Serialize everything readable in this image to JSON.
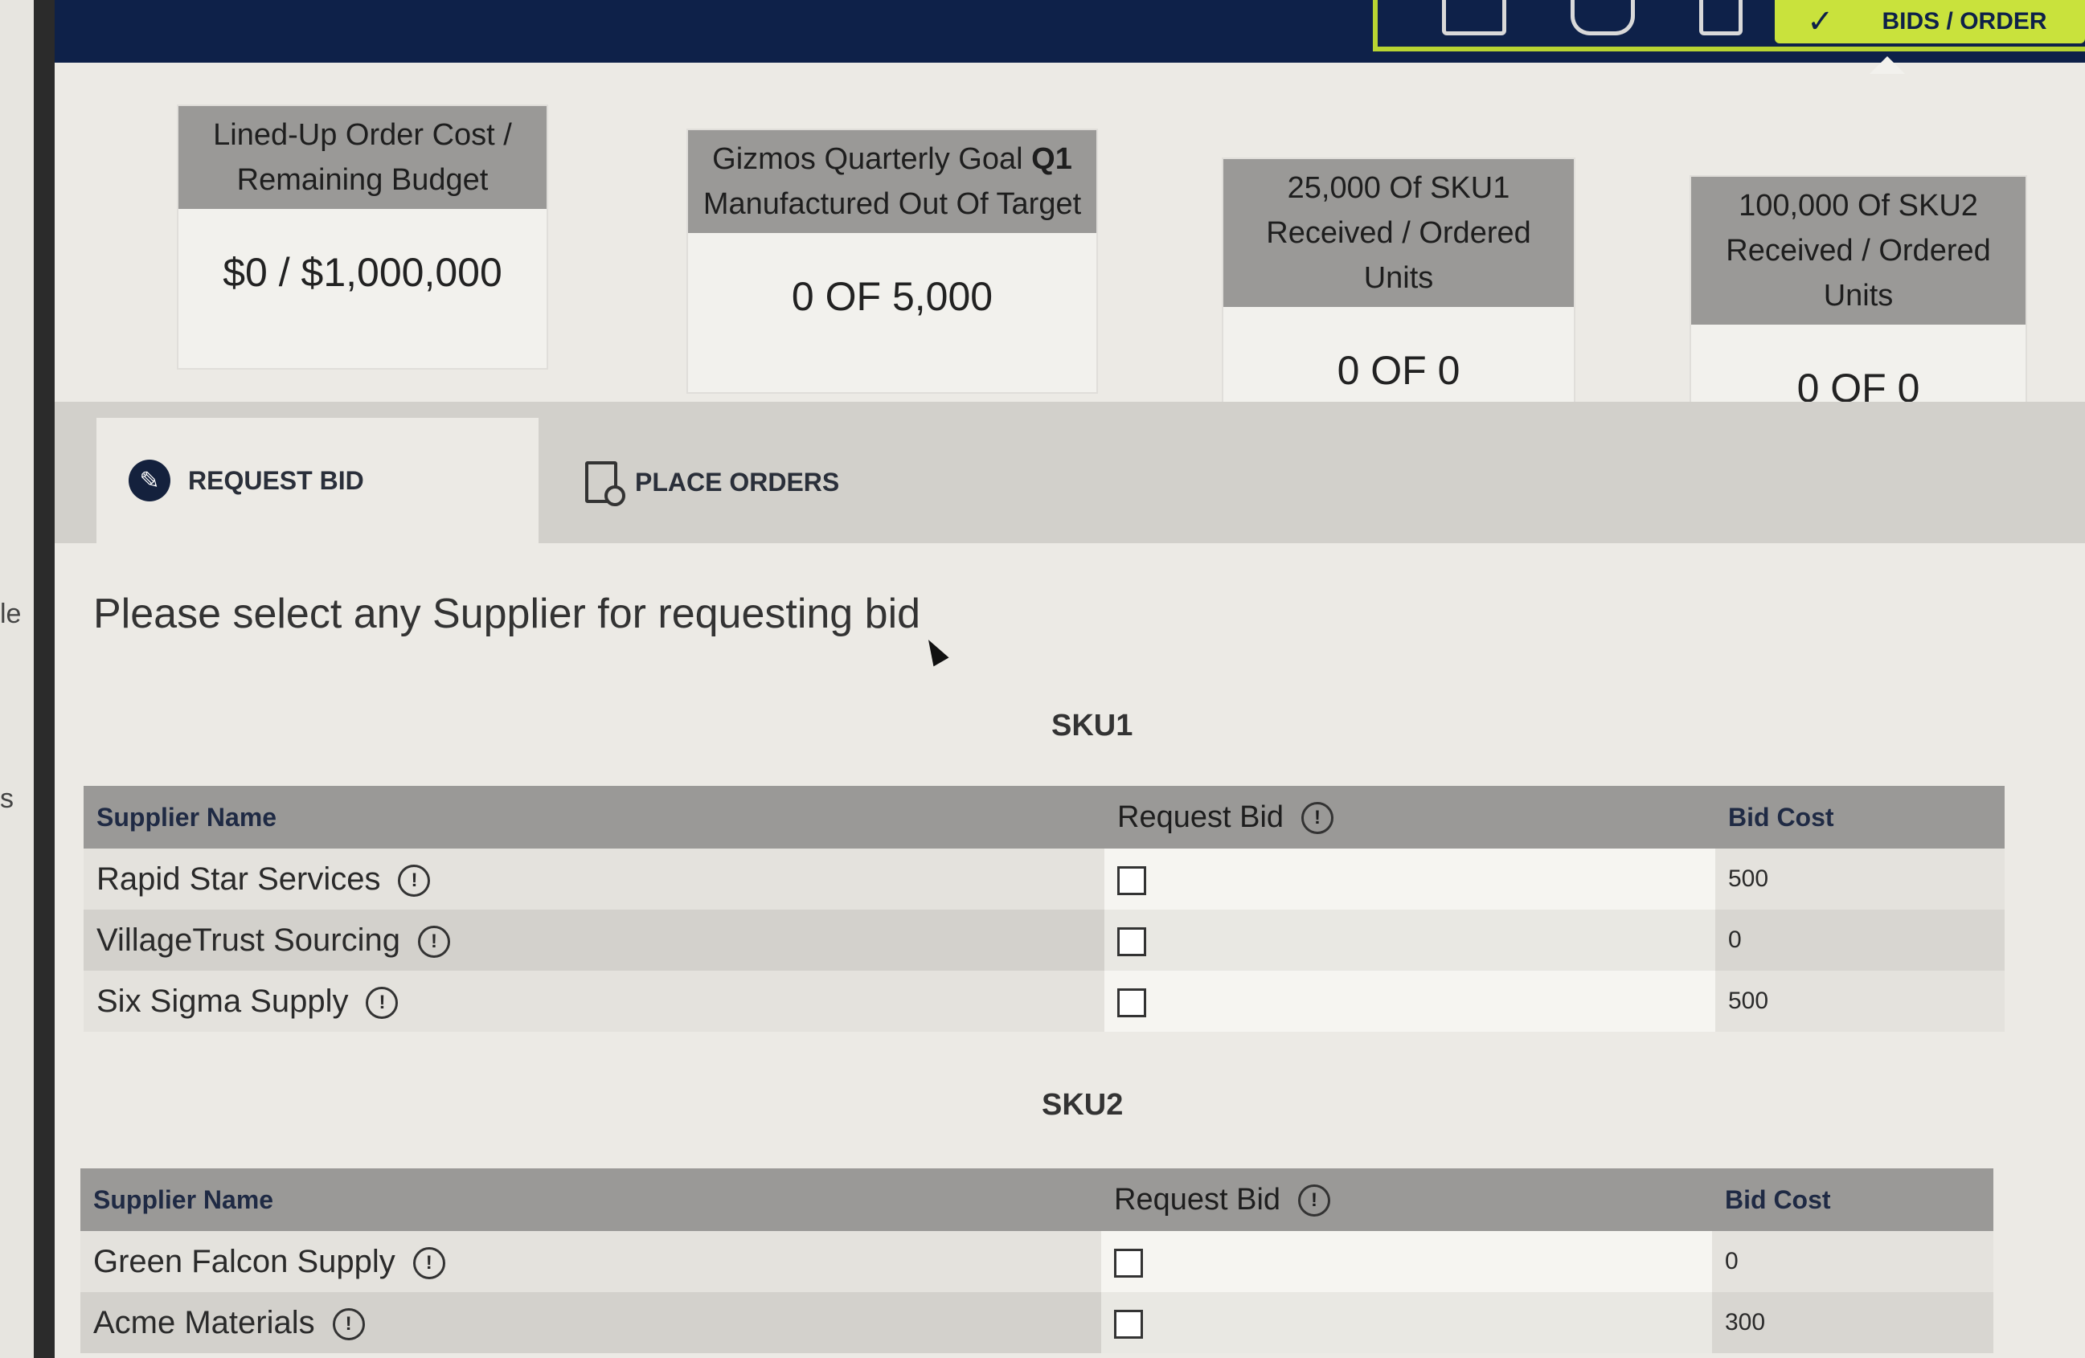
{
  "left_window": {
    "fragment_top": "le",
    "fragment_bottom": "s"
  },
  "topbar": {
    "bids_button_label": "BIDS / ORDER",
    "check_glyph": "✓"
  },
  "kpis": [
    {
      "header_line1": "Lined-Up Order Cost /",
      "header_line2": "Remaining Budget",
      "value": "$0 / $1,000,000"
    },
    {
      "header_line1_prefix": "Gizmos Quarterly Goal ",
      "header_line1_bold": "Q1",
      "header_line2": "Manufactured Out Of Target",
      "value": "0 OF 5,000"
    },
    {
      "header_line1": "25,000 Of SKU1",
      "header_line2": "Received / Ordered Units",
      "value": "0 OF 0"
    },
    {
      "header_line1": "100,000 Of SKU2",
      "header_line2": "Received / Ordered Units",
      "value": "0 OF 0"
    }
  ],
  "tabs": [
    {
      "label": "REQUEST BID",
      "icon": "gavel-icon",
      "active": true
    },
    {
      "label": "PLACE ORDERS",
      "icon": "document-search-icon",
      "active": false
    }
  ],
  "prompt": "Please select any Supplier for requesting bid",
  "columns": {
    "supplier": "Supplier Name",
    "request": "Request Bid",
    "cost": "Bid Cost"
  },
  "info_glyph": "!",
  "sku1": {
    "title": "SKU1",
    "rows": [
      {
        "supplier": "Rapid Star Services",
        "checked": false,
        "cost": "500"
      },
      {
        "supplier": "VillageTrust Sourcing",
        "checked": false,
        "cost": "0"
      },
      {
        "supplier": "Six Sigma Supply",
        "checked": false,
        "cost": "500"
      }
    ]
  },
  "sku2": {
    "title": "SKU2",
    "rows": [
      {
        "supplier": "Green Falcon Supply",
        "checked": false,
        "cost": "0"
      },
      {
        "supplier": "Acme Materials",
        "checked": false,
        "cost": "300"
      }
    ]
  }
}
